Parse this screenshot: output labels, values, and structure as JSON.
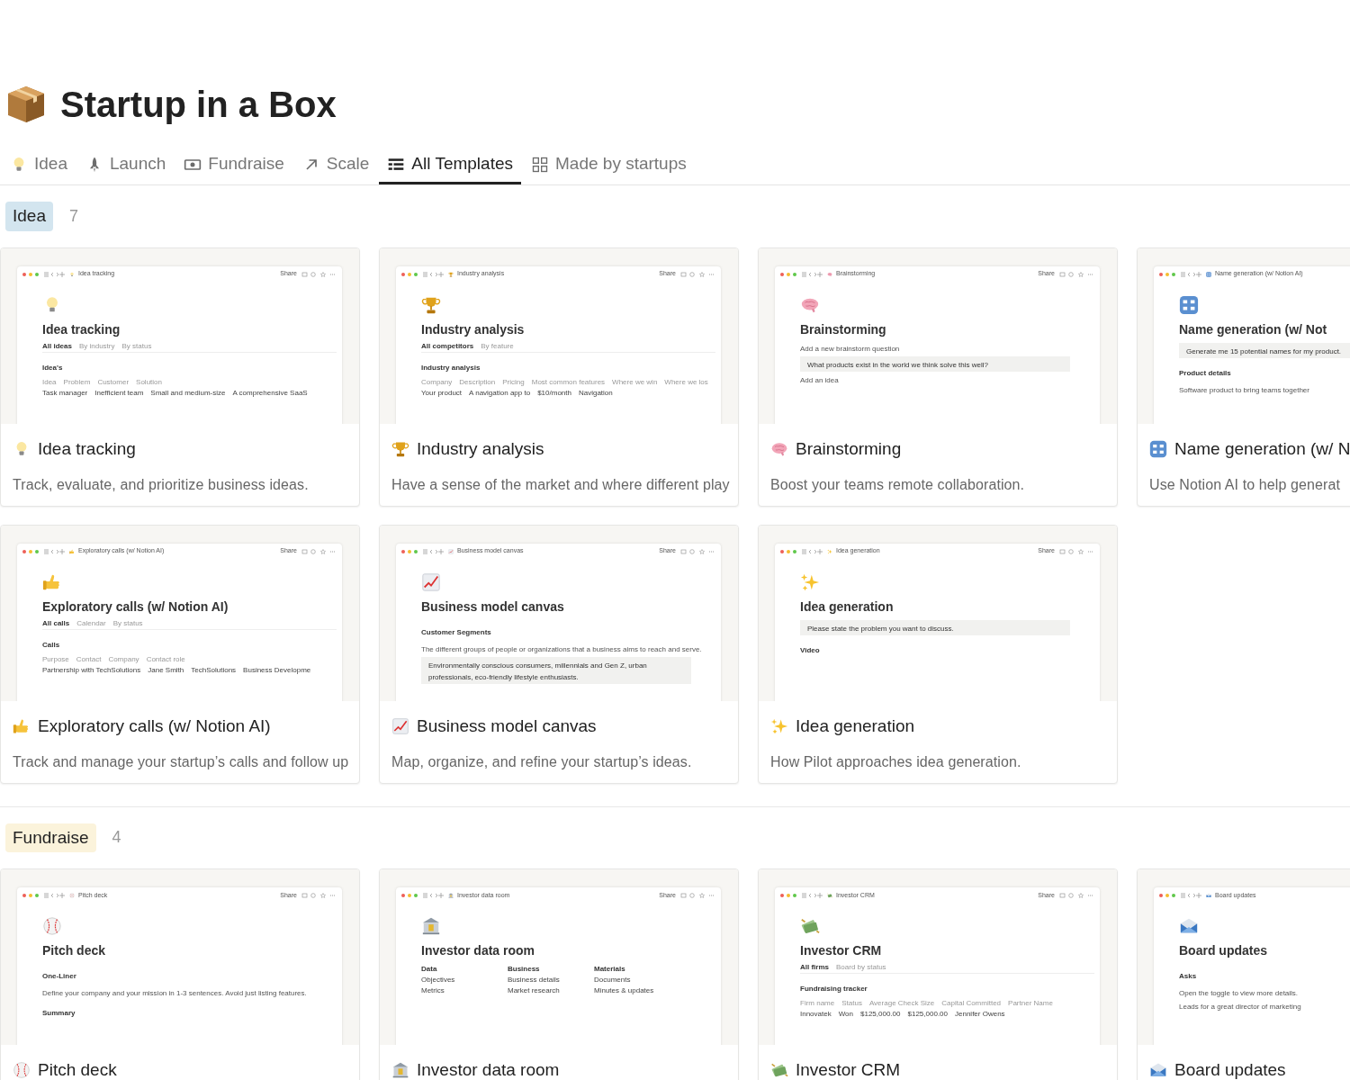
{
  "page": {
    "title": "Startup in a Box"
  },
  "tabs": [
    {
      "label": "Idea",
      "selected": false
    },
    {
      "label": "Launch",
      "selected": false
    },
    {
      "label": "Fundraise",
      "selected": false
    },
    {
      "label": "Scale",
      "selected": false
    },
    {
      "label": "All Templates",
      "selected": true
    },
    {
      "label": "Made by startups",
      "selected": false
    }
  ],
  "groups": [
    {
      "name": "Idea",
      "color": "#d3e5ef",
      "count": "7",
      "cards": [
        {
          "title": "Idea tracking",
          "description": "Track, evaluate, and prioritize business ideas.",
          "preview": {
            "crumb": "Idea tracking",
            "share": "Share",
            "heading": "Idea tracking",
            "lines": [
              {
                "kind": "tabs",
                "cells": [
                  "All ideas",
                  "By industry",
                  "By status"
                ]
              },
              {
                "kind": "section",
                "cells": [
                  "Idea's"
                ]
              },
              {
                "kind": "header",
                "cells": [
                  "Idea",
                  "Problem",
                  "Customer",
                  "Solution"
                ]
              },
              {
                "kind": "row",
                "cells": [
                  "Task manager",
                  "Inefficient team",
                  "Small and medium-size",
                  "A comprehensive SaaS"
                ]
              }
            ]
          }
        },
        {
          "title": "Industry analysis",
          "description": "Have a sense of the market and where different play",
          "preview": {
            "crumb": "Industry analysis",
            "share": "Share",
            "heading": "Industry analysis",
            "lines": [
              {
                "kind": "tabs",
                "cells": [
                  "All competitors",
                  "By feature"
                ]
              },
              {
                "kind": "section",
                "cells": [
                  "Industry analysis"
                ]
              },
              {
                "kind": "header",
                "cells": [
                  "Company",
                  "Description",
                  "Pricing",
                  "Most common features",
                  "Where we win",
                  "Where we los"
                ]
              },
              {
                "kind": "row",
                "cells": [
                  "Your product",
                  "A navigation app to",
                  "$10/month",
                  "Navigation"
                ]
              }
            ]
          }
        },
        {
          "title": "Brainstorming",
          "description": "Boost your teams remote collaboration.",
          "preview": {
            "crumb": "Brainstorming",
            "share": "Share",
            "heading": "Brainstorming",
            "lines": [
              {
                "kind": "text",
                "cells": [
                  "Add a new brainstorm question"
                ]
              },
              {
                "kind": "callout",
                "cells": [
                  "What products exist in the world we think solve this well?"
                ]
              },
              {
                "kind": "text",
                "cells": [
                  "Add an idea"
                ]
              }
            ]
          }
        },
        {
          "title": "Name generation (w/ N",
          "description": "Use Notion AI to help generat",
          "preview": {
            "crumb": "Name generation (w/ Notion AI)",
            "heading": "Name generation (w/ Not",
            "lines": [
              {
                "kind": "callout",
                "cells": [
                  "Generate me 15 potential names for my product."
                ]
              },
              {
                "kind": "section",
                "cells": [
                  "Product details"
                ]
              },
              {
                "kind": "text",
                "cells": [
                  "Software product to bring teams together"
                ]
              }
            ]
          }
        },
        {
          "title": "Exploratory calls (w/ Notion AI)",
          "description": "Track and manage your startup’s calls and follow up",
          "preview": {
            "crumb": "Exploratory calls (w/ Notion AI)",
            "share": "Share",
            "heading": "Exploratory calls (w/ Notion AI)",
            "lines": [
              {
                "kind": "tabs",
                "cells": [
                  "All calls",
                  "Calendar",
                  "By status"
                ]
              },
              {
                "kind": "section",
                "cells": [
                  "Calls"
                ]
              },
              {
                "kind": "header",
                "cells": [
                  "Purpose",
                  "Contact",
                  "Company",
                  "Contact role"
                ]
              },
              {
                "kind": "row",
                "cells": [
                  "Partnership with TechSolutions",
                  "Jane Smith",
                  "TechSolutions",
                  "Business Developme"
                ]
              }
            ]
          }
        },
        {
          "title": "Business model canvas",
          "description": "Map, organize, and refine your startup’s ideas.",
          "preview": {
            "crumb": "Business model canvas",
            "share": "Share",
            "heading": "Business model canvas",
            "lines": [
              {
                "kind": "section",
                "cells": [
                  "Customer Segments"
                ]
              },
              {
                "kind": "text",
                "cells": [
                  "The different groups of people or organizations that a business aims to reach and serve."
                ]
              },
              {
                "kind": "callout",
                "cells": [
                  "Environmentally conscious consumers, millennials and Gen Z, urban professionals, eco-friendly lifestyle enthusiasts."
                ]
              }
            ]
          }
        },
        {
          "title": "Idea generation",
          "description": "How Pilot approaches idea generation.",
          "preview": {
            "crumb": "Idea generation",
            "share": "Share",
            "heading": "Idea generation",
            "lines": [
              {
                "kind": "callout",
                "cells": [
                  "Please state the problem you want to discuss."
                ]
              },
              {
                "kind": "section",
                "cells": [
                  "Video"
                ]
              }
            ]
          }
        }
      ]
    },
    {
      "name": "Fundraise",
      "color": "#fbf3db",
      "count": "4",
      "cards": [
        {
          "title": "Pitch deck",
          "preview": {
            "crumb": "Pitch deck",
            "share": "Share",
            "heading": "Pitch deck",
            "lines": [
              {
                "kind": "section",
                "cells": [
                  "One-Liner"
                ]
              },
              {
                "kind": "text",
                "cells": [
                  "Define your company and your mission in 1-3 sentences. Avoid just listing features."
                ]
              },
              {
                "kind": "section",
                "cells": [
                  "Summary"
                ]
              }
            ]
          }
        },
        {
          "title": "Investor data room",
          "preview": {
            "crumb": "Investor data room",
            "share": "Share",
            "heading": "Investor data room",
            "lines": [
              {
                "kind": "columns",
                "cells": [
                  "Data",
                  "Business",
                  "Materials"
                ]
              },
              {
                "kind": "row",
                "cells": [
                  "Objectives",
                  "Business details",
                  "Documents"
                ]
              },
              {
                "kind": "row",
                "cells": [
                  "Metrics",
                  "Market research",
                  "Minutes & updates"
                ]
              }
            ]
          }
        },
        {
          "title": "Investor CRM",
          "preview": {
            "crumb": "Investor CRM",
            "share": "Share",
            "heading": "Investor CRM",
            "lines": [
              {
                "kind": "tabs",
                "cells": [
                  "All firms",
                  "Board by status"
                ]
              },
              {
                "kind": "section",
                "cells": [
                  "Fundraising tracker"
                ]
              },
              {
                "kind": "header",
                "cells": [
                  "Firm name",
                  "Status",
                  "Average Check Size",
                  "Capital Committed",
                  "Partner Name"
                ]
              },
              {
                "kind": "row",
                "cells": [
                  "Innovatek",
                  "Won",
                  "$125,000.00",
                  "$125,000.00",
                  "Jennifer Owens"
                ]
              }
            ]
          }
        },
        {
          "title": "Board updates",
          "preview": {
            "crumb": "Board updates",
            "heading": "Board updates",
            "lines": [
              {
                "kind": "section",
                "cells": [
                  "Asks"
                ]
              },
              {
                "kind": "text",
                "cells": [
                  "Open the toggle to view more details."
                ]
              },
              {
                "kind": "text",
                "cells": [
                  "Leads for a great director of marketing"
                ]
              }
            ]
          }
        }
      ]
    }
  ]
}
